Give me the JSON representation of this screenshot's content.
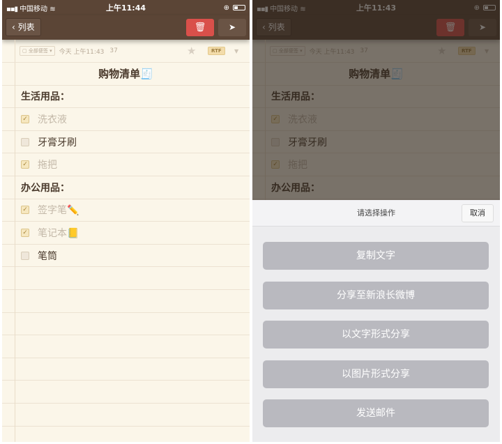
{
  "left": {
    "status": {
      "carrier": "中国移动",
      "time": "上午11:44"
    }
  },
  "right": {
    "status": {
      "carrier": "中国移动",
      "time": "上午11:43"
    }
  },
  "toolbar": {
    "back_label": "列表",
    "delete_icon": "trash-icon",
    "send_icon": "paper-plane-icon"
  },
  "note": {
    "folder": "全部便签",
    "date": "今天 上午11:43",
    "count": "37",
    "format": "RTF",
    "title": "购物清单🧾",
    "rows": [
      {
        "type": "heading",
        "text": "生活用品："
      },
      {
        "type": "item",
        "text": "洗衣液",
        "checked": true
      },
      {
        "type": "item",
        "text": "牙膏牙刷",
        "checked": false
      },
      {
        "type": "item",
        "text": "拖把",
        "checked": true
      },
      {
        "type": "heading",
        "text": "办公用品："
      },
      {
        "type": "item",
        "text": "签字笔✏️",
        "checked": true
      },
      {
        "type": "item",
        "text": "笔记本📒",
        "checked": true
      },
      {
        "type": "item",
        "text": "笔筒",
        "checked": false
      }
    ]
  },
  "sheet": {
    "title": "请选择操作",
    "cancel": "取消",
    "actions": [
      "复制文字",
      "分享至新浪长微博",
      "以文字形式分享",
      "以图片形式分享",
      "发送邮件"
    ]
  },
  "colors": {
    "toolbar": "#5b4536",
    "delete": "#d9504a",
    "paper": "#fbf6e9",
    "action": "#b9b9bf"
  }
}
